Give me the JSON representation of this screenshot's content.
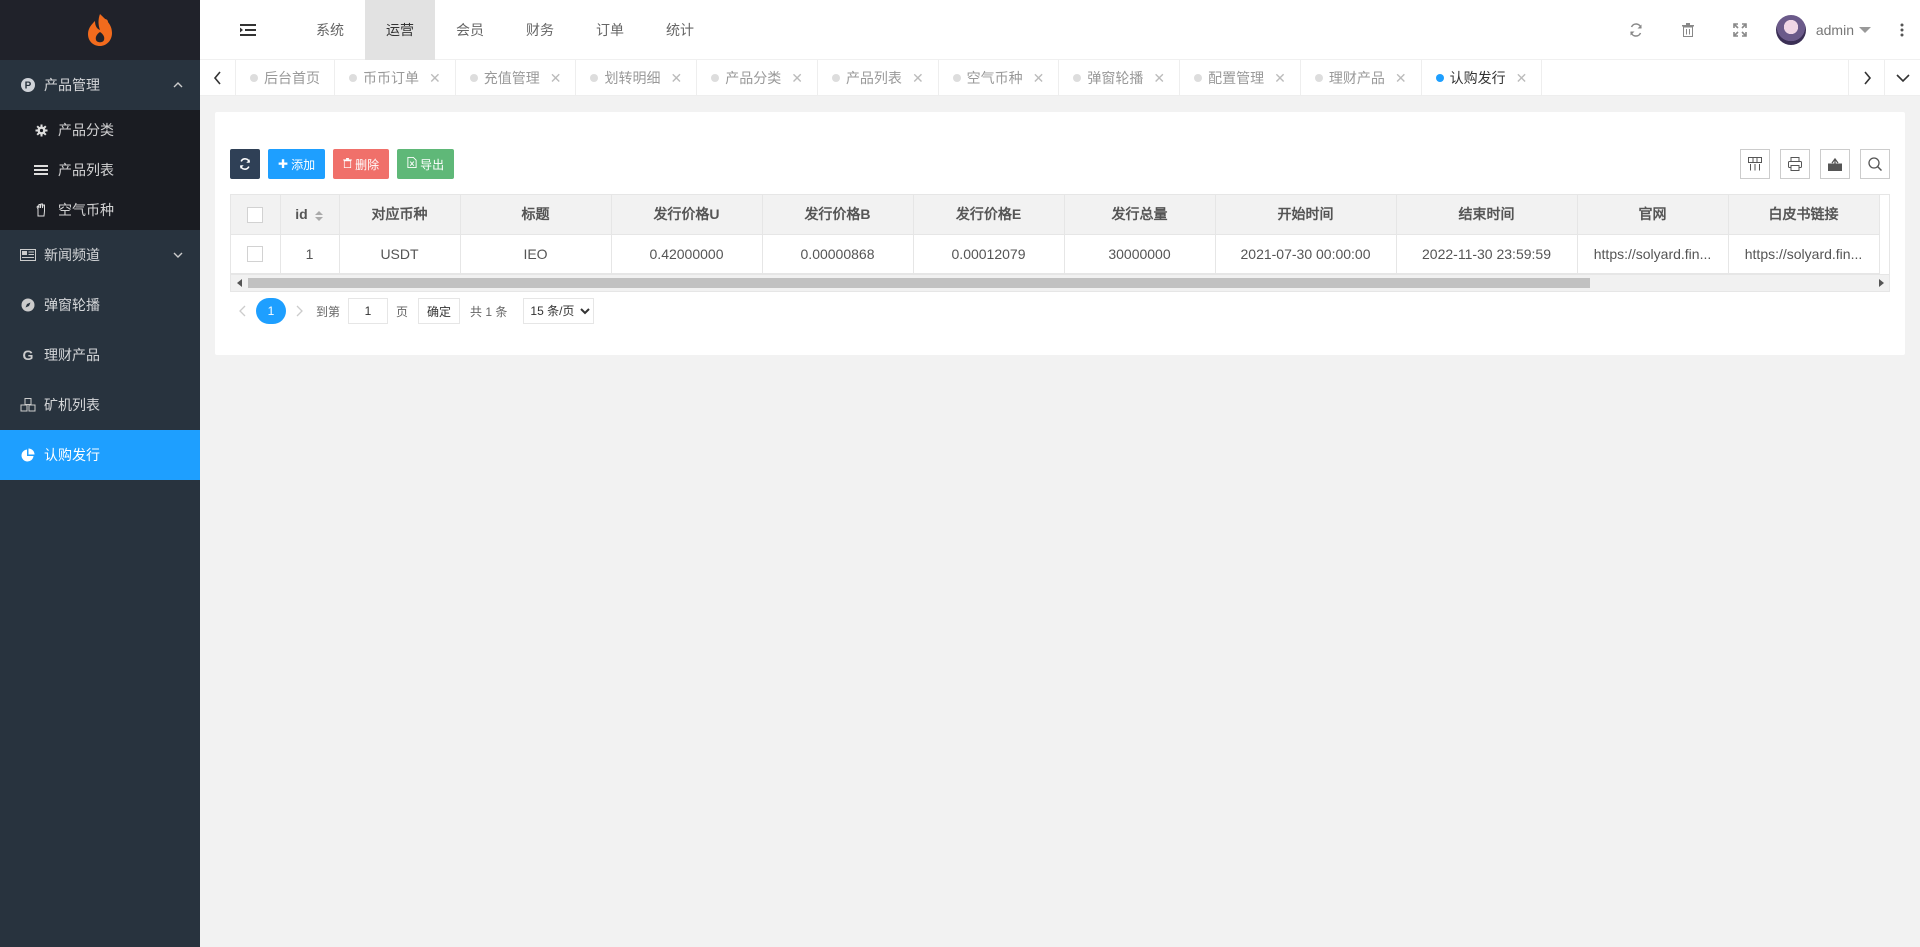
{
  "sidebar": {
    "menus": [
      {
        "label": "产品管理",
        "icon": "p-circle-icon",
        "open": true,
        "children": [
          {
            "label": "产品分类",
            "icon": "gear-icon"
          },
          {
            "label": "产品列表",
            "icon": "list-icon"
          },
          {
            "label": "空气币种",
            "icon": "hand-icon"
          }
        ]
      },
      {
        "label": "新闻频道",
        "icon": "newspaper-icon"
      },
      {
        "label": "弹窗轮播",
        "icon": "compass-icon"
      },
      {
        "label": "理财产品",
        "icon": "google-icon"
      },
      {
        "label": "矿机列表",
        "icon": "cubes-icon"
      },
      {
        "label": "认购发行",
        "icon": "pie-chart-icon",
        "active": true
      }
    ]
  },
  "header": {
    "nav": [
      "系统",
      "运营",
      "会员",
      "财务",
      "订单",
      "统计"
    ],
    "active_nav": "运营",
    "user": "admin"
  },
  "tabs": {
    "items": [
      "后台首页",
      "币币订单",
      "充值管理",
      "划转明细",
      "产品分类",
      "产品列表",
      "空气币种",
      "弹窗轮播",
      "配置管理",
      "理财产品",
      "认购发行"
    ],
    "active": "认购发行"
  },
  "toolbar": {
    "add": "添加",
    "delete": "删除",
    "export": "导出"
  },
  "table": {
    "columns": [
      "id",
      "对应币种",
      "标题",
      "发行价格U",
      "发行价格B",
      "发行价格E",
      "发行总量",
      "开始时间",
      "结束时间",
      "官网",
      "白皮书链接"
    ],
    "rows": [
      [
        "1",
        "USDT",
        "IEO",
        "0.42000000",
        "0.00000868",
        "0.00012079",
        "30000000",
        "2021-07-30 00:00:00",
        "2022-11-30 23:59:59",
        "https://solyard.fin...",
        "https://solyard.fin..."
      ]
    ]
  },
  "pager": {
    "current": "1",
    "goto_label": "到第",
    "goto_value": "1",
    "page_unit": "页",
    "confirm": "确定",
    "total": "共 1 条",
    "page_size": "15 条/页"
  },
  "colors": {
    "accent": "#1e9fff",
    "sidebar": "#28333e"
  }
}
